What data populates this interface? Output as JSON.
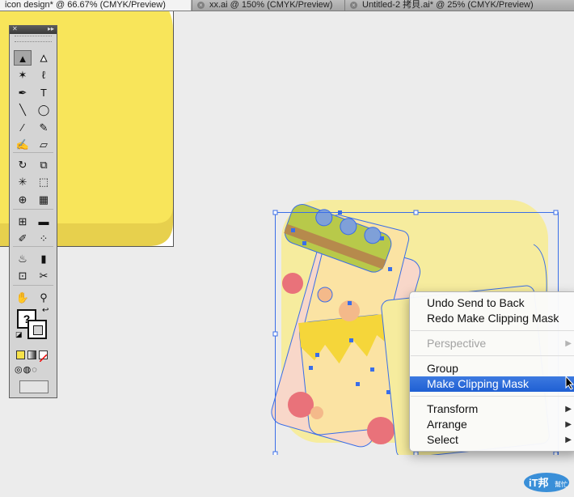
{
  "tabs": [
    {
      "title": "icon design* @ 66.67% (CMYK/Preview)",
      "active": true
    },
    {
      "title": "xx.ai @ 150% (CMYK/Preview)",
      "active": false
    },
    {
      "title": "Untitled-2 拷貝.ai* @ 25% (CMYK/Preview)",
      "active": false
    }
  ],
  "tools_panel": {
    "fill_swatch_symbol": "?",
    "stroke_swatch_symbol": "?",
    "tools": [
      {
        "name": "selection-tool",
        "glyph": "▲"
      },
      {
        "name": "direct-selection-tool",
        "glyph": "▲"
      },
      {
        "name": "magic-wand-tool",
        "glyph": "✶"
      },
      {
        "name": "lasso-tool",
        "glyph": "ℓ"
      },
      {
        "name": "pen-tool",
        "glyph": "✒"
      },
      {
        "name": "type-tool",
        "glyph": "T"
      },
      {
        "name": "line-tool",
        "glyph": "╲"
      },
      {
        "name": "ellipse-tool",
        "glyph": "◯"
      },
      {
        "name": "paintbrush-tool",
        "glyph": "∕"
      },
      {
        "name": "pencil-tool",
        "glyph": "✎"
      },
      {
        "name": "blob-brush-tool",
        "glyph": "✍"
      },
      {
        "name": "eraser-tool",
        "glyph": "▱"
      },
      {
        "name": "rotate-tool",
        "glyph": "↻"
      },
      {
        "name": "scale-tool",
        "glyph": "⧉"
      },
      {
        "name": "warp-tool",
        "glyph": "✳"
      },
      {
        "name": "free-transform-tool",
        "glyph": "⬚"
      },
      {
        "name": "shape-builder-tool",
        "glyph": "⊕"
      },
      {
        "name": "perspective-grid-tool",
        "glyph": "▦"
      },
      {
        "name": "mesh-tool",
        "glyph": "⊞"
      },
      {
        "name": "gradient-tool",
        "glyph": "▬"
      },
      {
        "name": "eyedropper-tool",
        "glyph": "✐"
      },
      {
        "name": "blend-tool",
        "glyph": "⁘"
      },
      {
        "name": "symbol-sprayer-tool",
        "glyph": "♨"
      },
      {
        "name": "column-graph-tool",
        "glyph": "▮"
      },
      {
        "name": "artboard-tool",
        "glyph": "⊡"
      },
      {
        "name": "slice-tool",
        "glyph": "✂"
      },
      {
        "name": "hand-tool",
        "glyph": "✋"
      },
      {
        "name": "zoom-tool",
        "glyph": "⚲"
      }
    ]
  },
  "context_menu": {
    "items": [
      {
        "label": "Undo Send to Back",
        "state": "normal",
        "submenu": false
      },
      {
        "label": "Redo Make Clipping Mask",
        "state": "normal",
        "submenu": false
      },
      {
        "label": "Perspective",
        "state": "disabled",
        "submenu": true
      },
      {
        "label": "Group",
        "state": "normal",
        "submenu": false
      },
      {
        "label": "Make Clipping Mask",
        "state": "highlighted",
        "submenu": false
      },
      {
        "label": "Transform",
        "state": "normal",
        "submenu": true
      },
      {
        "label": "Arrange",
        "state": "normal",
        "submenu": true
      },
      {
        "label": "Select",
        "state": "normal",
        "submenu": true
      }
    ],
    "submenu_arrow": "▶"
  },
  "colors": {
    "artboard_yellow": "#f8e55a",
    "artboard_yellow_shadow": "#e7d04d",
    "rounded_rect": "#f6ec9e",
    "pink_shape": "#f8d7c9",
    "red_dot": "#e9727a",
    "olive_hat": "#b8c94a",
    "brown_band": "#b68a4c",
    "selection_blue": "#3a6ee8",
    "menu_highlight": "#2a69d9"
  },
  "logo": {
    "text": "iT邦",
    "subtext": "幫忙"
  }
}
